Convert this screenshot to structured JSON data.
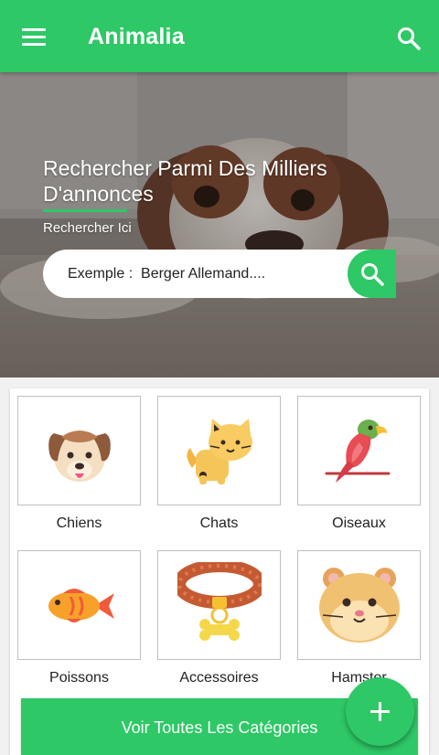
{
  "appbar": {
    "title": "Animalia",
    "menu_icon": "hamburger-menu-icon",
    "search_icon": "search-icon"
  },
  "hero": {
    "title": "Rechercher Parmi Des Milliers D'annonces",
    "subtitle": "Rechercher Ici",
    "search": {
      "placeholder": "Exemple :  Berger Allemand....",
      "button_icon": "search-icon"
    }
  },
  "categories": [
    {
      "label": "Chiens",
      "icon": "dog-icon"
    },
    {
      "label": "Chats",
      "icon": "cat-icon"
    },
    {
      "label": "Oiseaux",
      "icon": "parrot-icon"
    },
    {
      "label": "Poissons",
      "icon": "fish-icon"
    },
    {
      "label": "Accessoires",
      "icon": "collar-icon"
    },
    {
      "label": "Hamster",
      "icon": "hamster-icon"
    }
  ],
  "see_all_label": "Voir Toutes Les Catégories",
  "fab_icon": "plus-icon",
  "colors": {
    "primary": "#2ec866",
    "text": "#222222"
  }
}
